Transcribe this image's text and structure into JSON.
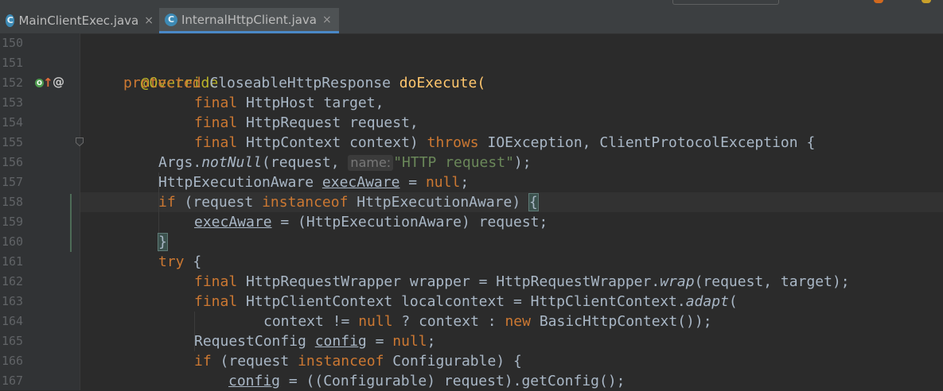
{
  "tabs": [
    {
      "label": "MainClientExec.java",
      "icon_letter": "C",
      "close": "×",
      "active": false
    },
    {
      "label": "InternalHttpClient.java",
      "icon_letter": "C",
      "close": "×",
      "active": true
    }
  ],
  "gutter": {
    "line_numbers": [
      "150",
      "151",
      "152",
      "153",
      "154",
      "155",
      "156",
      "157",
      "158",
      "159",
      "160",
      "161",
      "162",
      "163",
      "164",
      "165",
      "166",
      "167"
    ],
    "override_icon_letter": "O",
    "annotation_icon": "@",
    "arrow_icon": "↑"
  },
  "code": {
    "l151": {
      "annotation": "@Override"
    },
    "l152": {
      "kw_protected": "protected",
      "type": " CloseableHttpResponse ",
      "method": "doExecute",
      "paren": "("
    },
    "l153": {
      "kw_final": "final",
      "rest": " HttpHost target,"
    },
    "l154": {
      "kw_final": "final",
      "rest": " HttpRequest request,"
    },
    "l155": {
      "kw_final": "final",
      "mid": " HttpContext context) ",
      "kw_throws": "throws",
      "rest": " IOException, ClientProtocolException {"
    },
    "l156": {
      "a": "Args.",
      "b": "notNull",
      "c": "(request, ",
      "hint": "name:",
      "str": "\"HTTP request\"",
      "d": ");"
    },
    "l157": {
      "a": "HttpExecutionAware ",
      "var": "execAware",
      "b": " = ",
      "kw_null": "null",
      "c": ";"
    },
    "l158": {
      "kw_if": "if",
      "a": " (request ",
      "kw_instanceof": "instanceof",
      "b": " HttpExecutionAware) ",
      "brace": "{"
    },
    "l159": {
      "var": "execAware",
      "rest": " = (HttpExecutionAware) request;"
    },
    "l160": {
      "brace": "}"
    },
    "l161": {
      "kw_try": "try",
      "rest": " {"
    },
    "l162": {
      "kw_final": "final",
      "a": " HttpRequestWrapper wrapper = HttpRequestWrapper.",
      "b": "wrap",
      "c": "(request, target);"
    },
    "l163": {
      "kw_final": "final",
      "a": " HttpClientContext localcontext = HttpClientContext.",
      "b": "adapt",
      "c": "("
    },
    "l164": {
      "a": "context != ",
      "kw_null": "null",
      "b": " ? context : ",
      "kw_new": "new",
      "c": " BasicHttpContext());"
    },
    "l165": {
      "a": "RequestConfig ",
      "var": "config",
      "b": " = ",
      "kw_null": "null",
      "c": ";"
    },
    "l166": {
      "kw_if": "if",
      "a": " (request ",
      "kw_instanceof": "instanceof",
      "b": " Configurable) {"
    },
    "l167": {
      "var": "config",
      "rest": " = ((Configurable) request).getConfig();"
    }
  },
  "colors": {
    "background": "#2b2b2b",
    "gutter": "#313335",
    "keyword": "#cc7832",
    "annotation": "#bbb529",
    "string": "#6a8759",
    "method_decl": "#ffc66d",
    "text": "#a9b7c6",
    "tab_accent": "#4a88c7"
  }
}
